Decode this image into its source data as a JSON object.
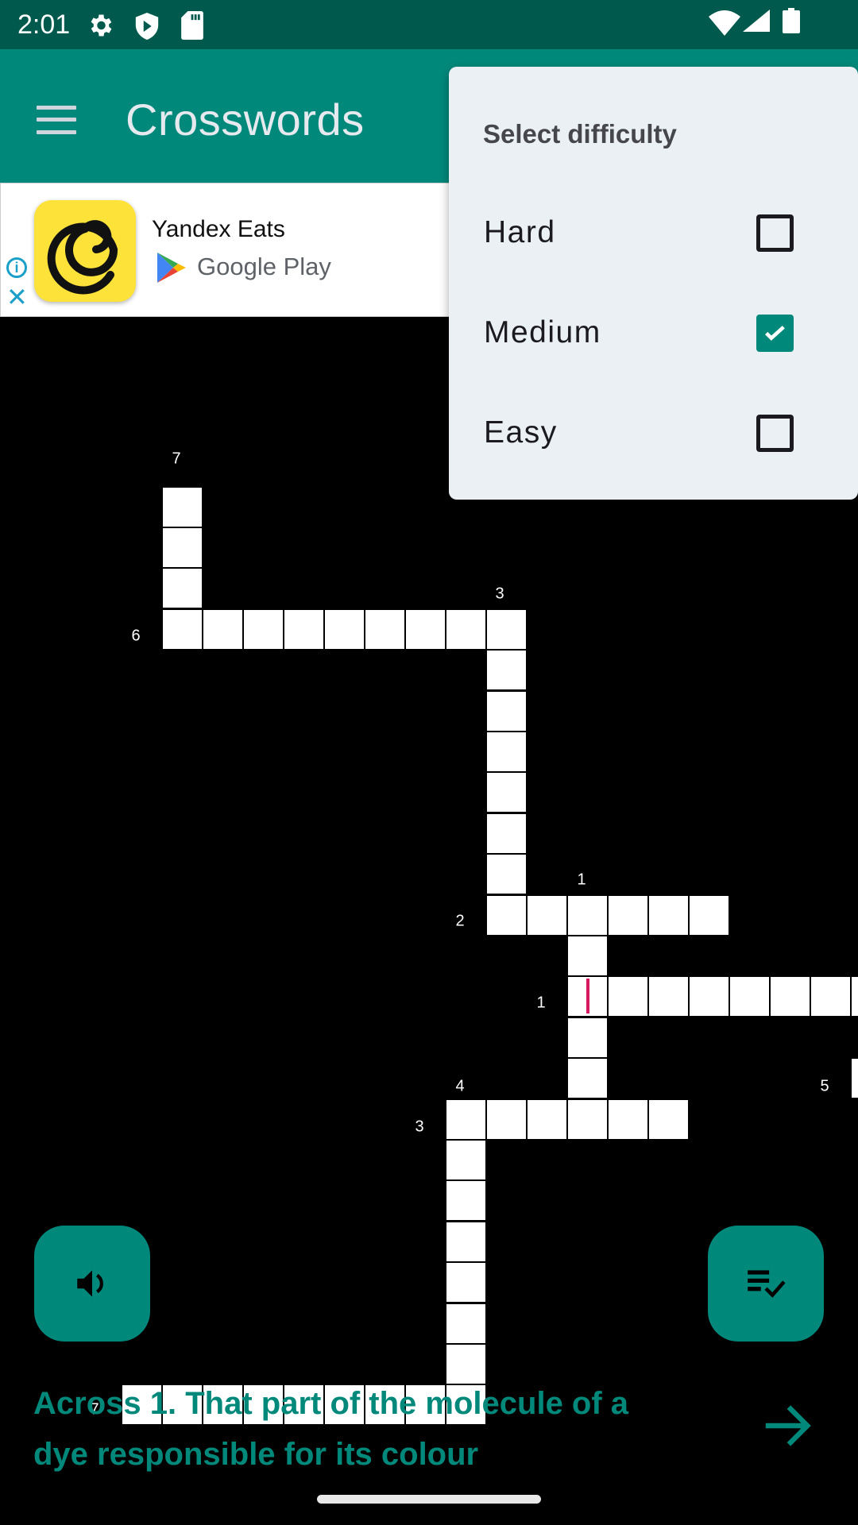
{
  "status_bar": {
    "time": "2:01",
    "icons": [
      "gear-icon",
      "shield-play-icon",
      "sd-card-icon",
      "wifi-icon",
      "signal-icon",
      "battery-icon"
    ]
  },
  "app_bar": {
    "title": "Crosswords",
    "menu_icon": "hamburger-icon"
  },
  "ad": {
    "app_name": "Yandex Eats",
    "store": "Google Play",
    "info_icon": "info-icon",
    "close_icon": "close-icon"
  },
  "difficulty_menu": {
    "title": "Select difficulty",
    "items": [
      {
        "label": "Hard",
        "checked": false
      },
      {
        "label": "Medium",
        "checked": true
      },
      {
        "label": "Easy",
        "checked": false
      }
    ]
  },
  "grid": {
    "clue_numbers": [
      "7",
      "6",
      "3",
      "1",
      "2",
      "1",
      "4",
      "3",
      "5",
      "7"
    ]
  },
  "clue": {
    "text": "Across 1. That part of the molecule of a dye responsible for its colour"
  },
  "buttons": {
    "speak_icon": "volume-icon",
    "check_icon": "playlist-check-icon",
    "next_icon": "arrow-right-icon"
  },
  "colors": {
    "primary": "#00897b",
    "status_bar": "#00594d",
    "cursor": "#d81b60",
    "menu_bg": "#eaf0f3"
  }
}
